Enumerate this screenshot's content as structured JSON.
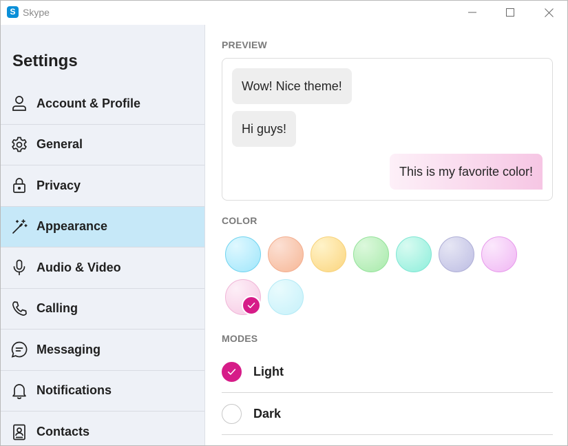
{
  "window": {
    "title": "Skype",
    "logo_letter": "S"
  },
  "sidebar": {
    "title": "Settings",
    "items": [
      {
        "label": "Account & Profile",
        "icon": "person-icon",
        "active": false
      },
      {
        "label": "General",
        "icon": "gear-icon",
        "active": false
      },
      {
        "label": "Privacy",
        "icon": "lock-icon",
        "active": false
      },
      {
        "label": "Appearance",
        "icon": "magic-wand-icon",
        "active": true
      },
      {
        "label": "Audio & Video",
        "icon": "microphone-icon",
        "active": false
      },
      {
        "label": "Calling",
        "icon": "phone-icon",
        "active": false
      },
      {
        "label": "Messaging",
        "icon": "chat-icon",
        "active": false
      },
      {
        "label": "Notifications",
        "icon": "bell-icon",
        "active": false
      },
      {
        "label": "Contacts",
        "icon": "contacts-icon",
        "active": false
      }
    ]
  },
  "preview": {
    "label": "PREVIEW",
    "incoming": [
      "Wow! Nice theme!",
      "Hi guys!"
    ],
    "outgoing": "This is my favorite color!"
  },
  "color": {
    "label": "COLOR",
    "swatches": [
      {
        "from": "#dff8ff",
        "to": "#9fe6fb",
        "border": "#6fd3ef"
      },
      {
        "from": "#fce0d4",
        "to": "#f6b796",
        "border": "#f3ad8e"
      },
      {
        "from": "#fff3c9",
        "to": "#fbd57e",
        "border": "#f7d27a"
      },
      {
        "from": "#dcf8dc",
        "to": "#a7eaaa",
        "border": "#94e29a"
      },
      {
        "from": "#d8fbf1",
        "to": "#8deedb",
        "border": "#7ee6d3"
      },
      {
        "from": "#e6e6f4",
        "to": "#bdbde3",
        "border": "#aeaed6"
      },
      {
        "from": "#fbe8fc",
        "to": "#f0b6f4",
        "border": "#e79aeb"
      },
      {
        "from": "#fdeff7",
        "to": "#f6c8e3",
        "border": "#f0b6d8"
      },
      {
        "from": "#e9fbfd",
        "to": "#c6f1fa",
        "border": "#b3eaf6"
      }
    ],
    "selected_index": 7,
    "accent": "#d61c88"
  },
  "modes": {
    "label": "MODES",
    "options": [
      {
        "label": "Light",
        "selected": true
      },
      {
        "label": "Dark",
        "selected": false
      }
    ]
  }
}
